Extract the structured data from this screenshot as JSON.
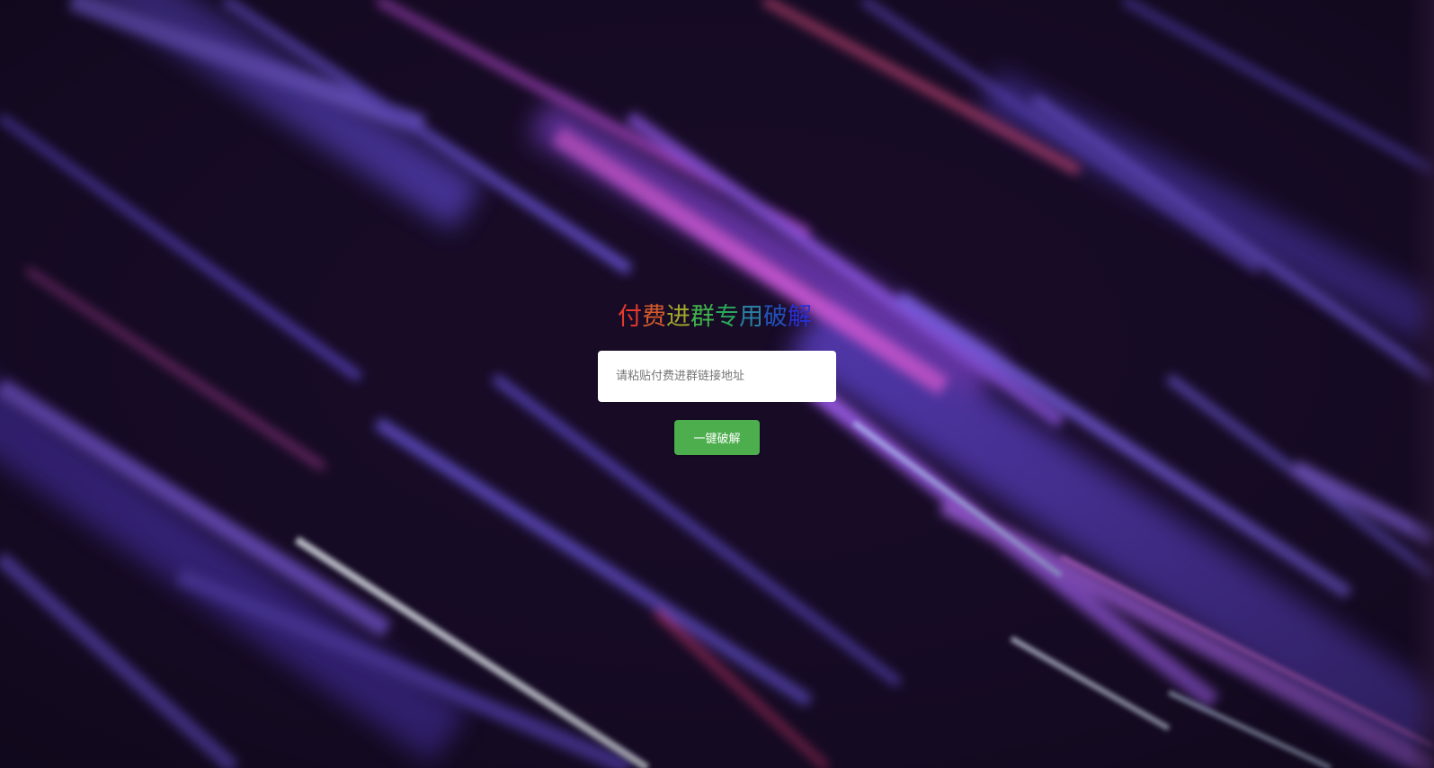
{
  "background": {
    "name": "purple-light-streaks-background",
    "colors": {
      "base": "#150a22",
      "violet": "#6b4fd8",
      "magenta": "#c04bd6",
      "pink": "#c2366b",
      "white_streak": "#e8f0ff"
    }
  },
  "title": {
    "chars": [
      {
        "text": "付",
        "color": "#e33a2d"
      },
      {
        "text": "费",
        "color": "#d45a2a"
      },
      {
        "text": "进",
        "color": "#9fa72a"
      },
      {
        "text": "群",
        "color": "#3fb24a"
      },
      {
        "text": "专",
        "color": "#2aa65a"
      },
      {
        "text": "用",
        "color": "#2a7fa2"
      },
      {
        "text": "破",
        "color": "#2350b8"
      },
      {
        "text": "解",
        "color": "#2a2fd0"
      }
    ]
  },
  "form": {
    "link_input": {
      "value": "",
      "placeholder": "请粘贴付费进群链接地址"
    },
    "crack_button": {
      "label": "一键破解",
      "color": "#4cae4c"
    }
  }
}
